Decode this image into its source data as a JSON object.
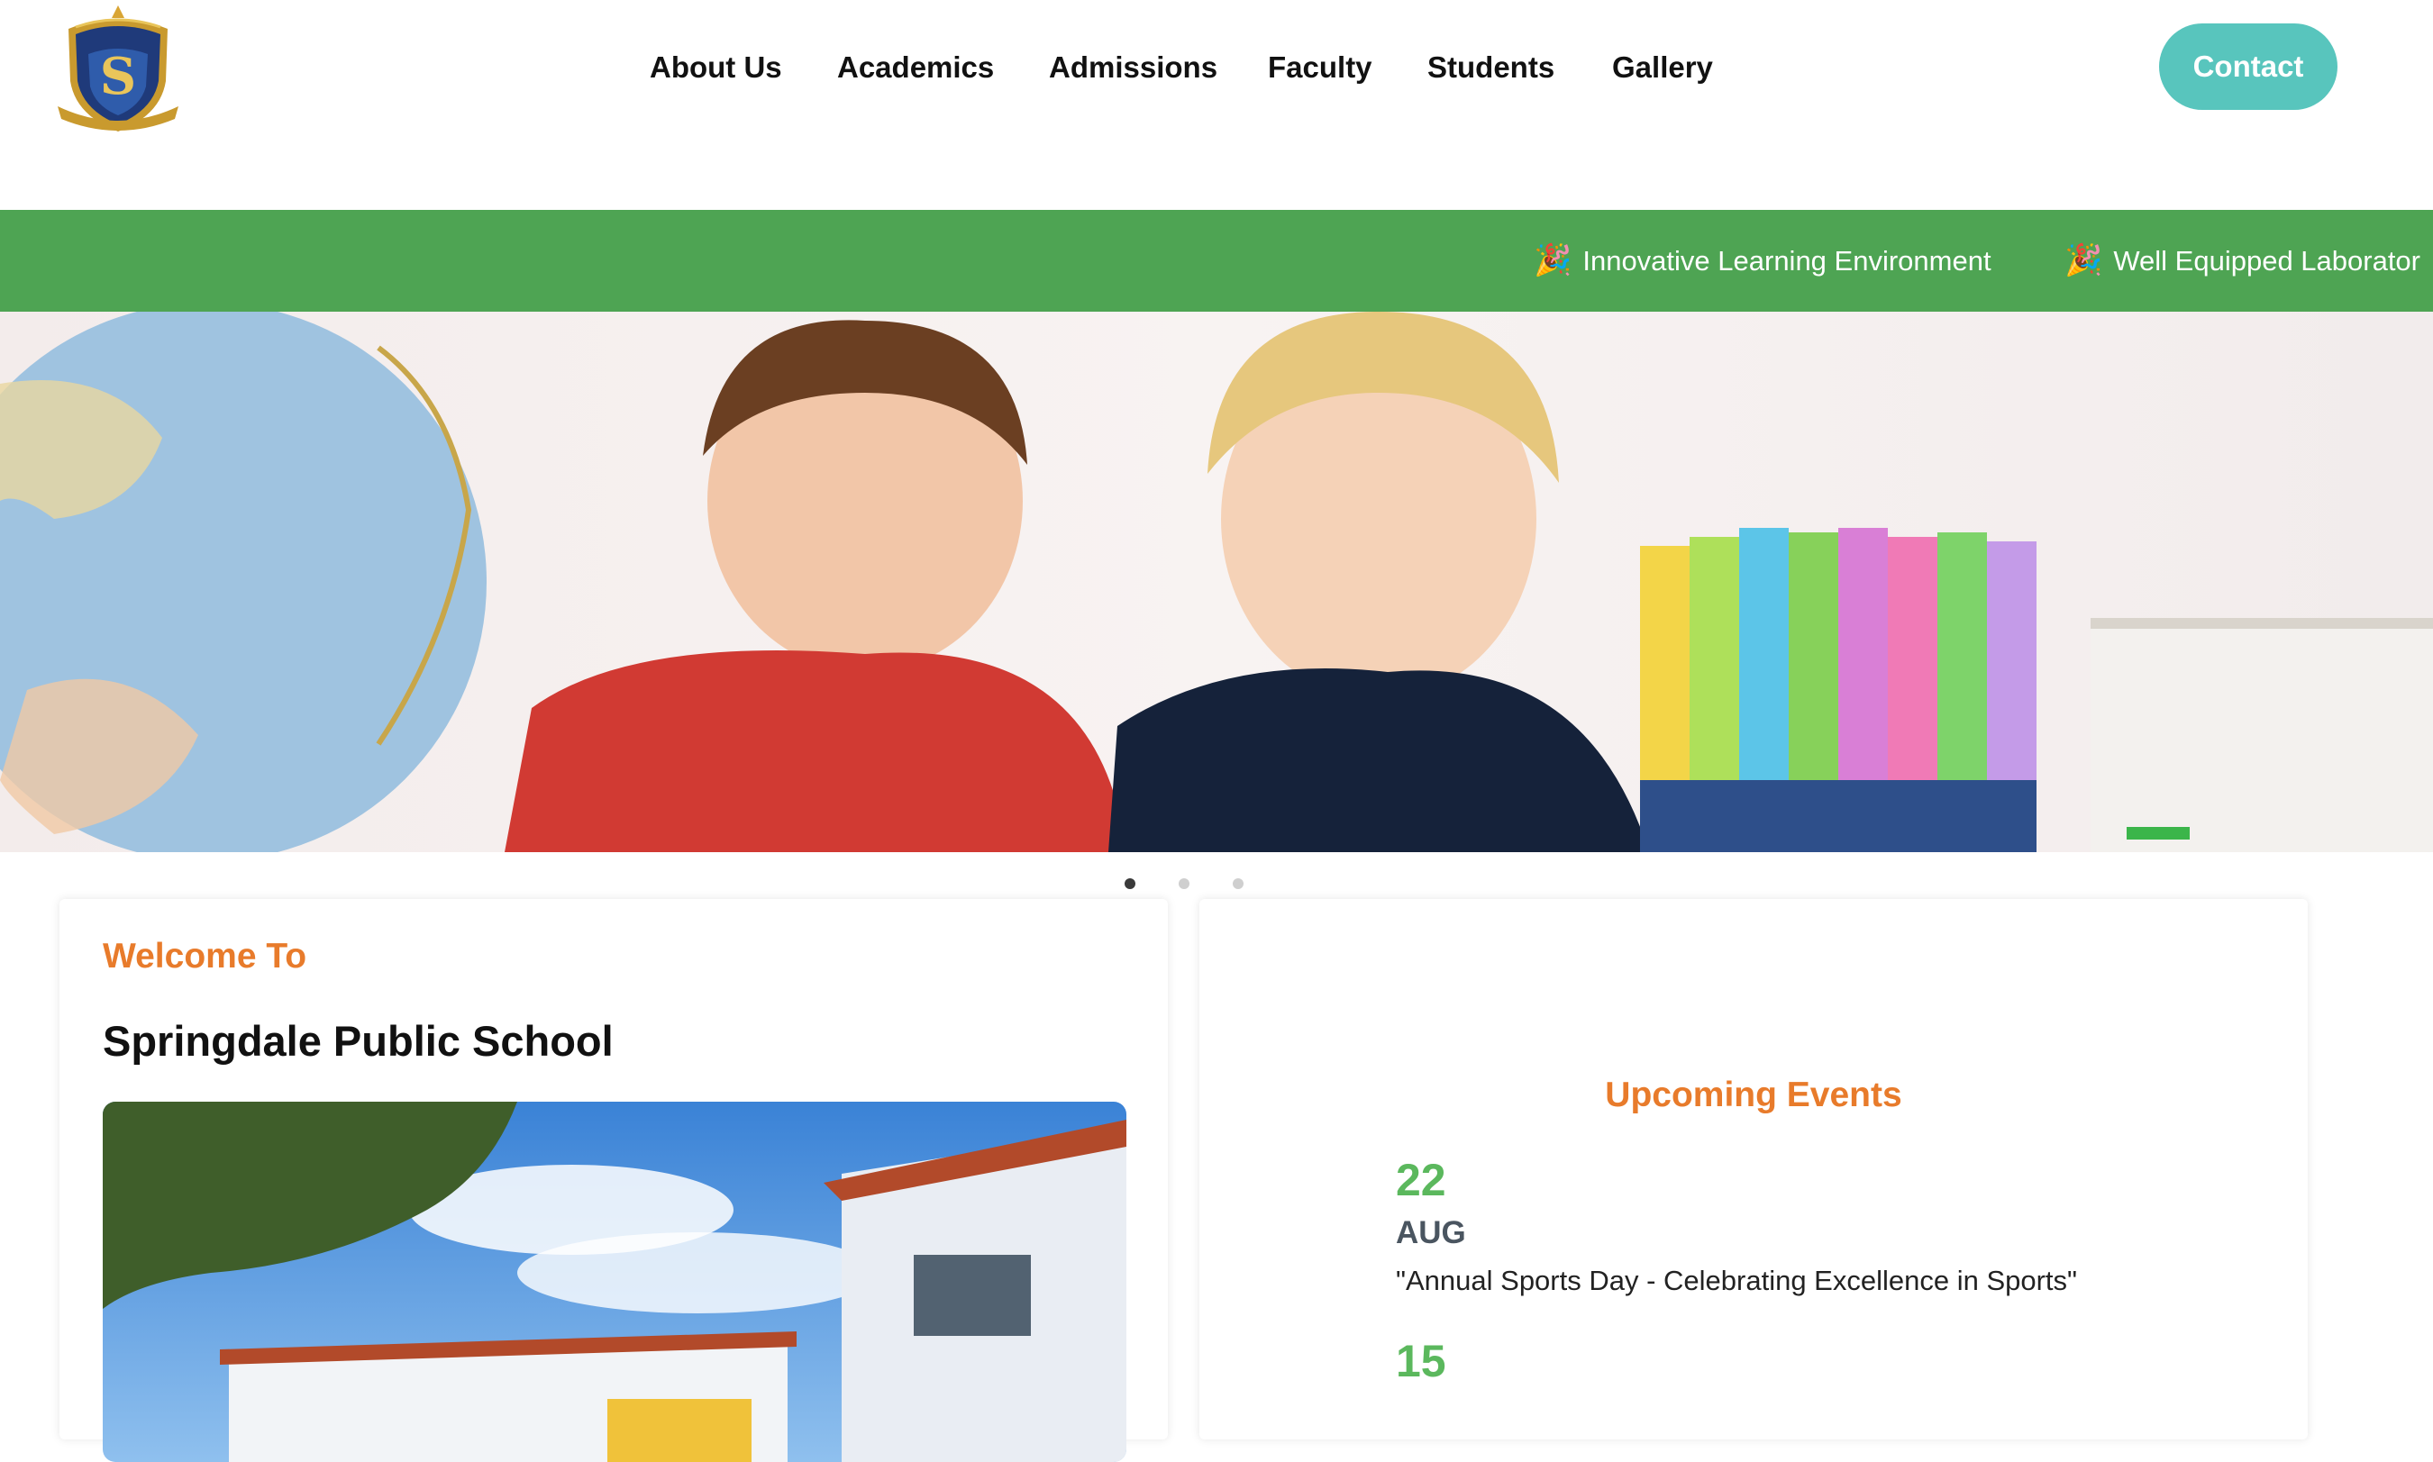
{
  "header": {
    "logo_text": "Springdale Public School",
    "nav": [
      "About Us",
      "Academics",
      "Admissions",
      "Faculty",
      "Students",
      "Gallery"
    ],
    "contact_label": "Contact"
  },
  "ticker": {
    "items": [
      "Innovative Learning Environment",
      "Well Equipped Laborator"
    ],
    "icon": "party-popper-icon"
  },
  "hero": {
    "slide_count": 3,
    "active_slide": 1
  },
  "welcome": {
    "kicker": "Welcome To",
    "school_name": "Springdale Public School"
  },
  "events": {
    "title": "Upcoming Events",
    "items": [
      {
        "day": "22",
        "month": "AUG",
        "title": "\"Annual Sports Day - Celebrating Excellence in Sports\""
      },
      {
        "day": "15",
        "month": "",
        "title": ""
      }
    ]
  },
  "colors": {
    "accent_orange": "#e87b2b",
    "ticker_green": "#4ea453",
    "event_green": "#5bb85d",
    "contact_teal": "#58c5bd"
  }
}
